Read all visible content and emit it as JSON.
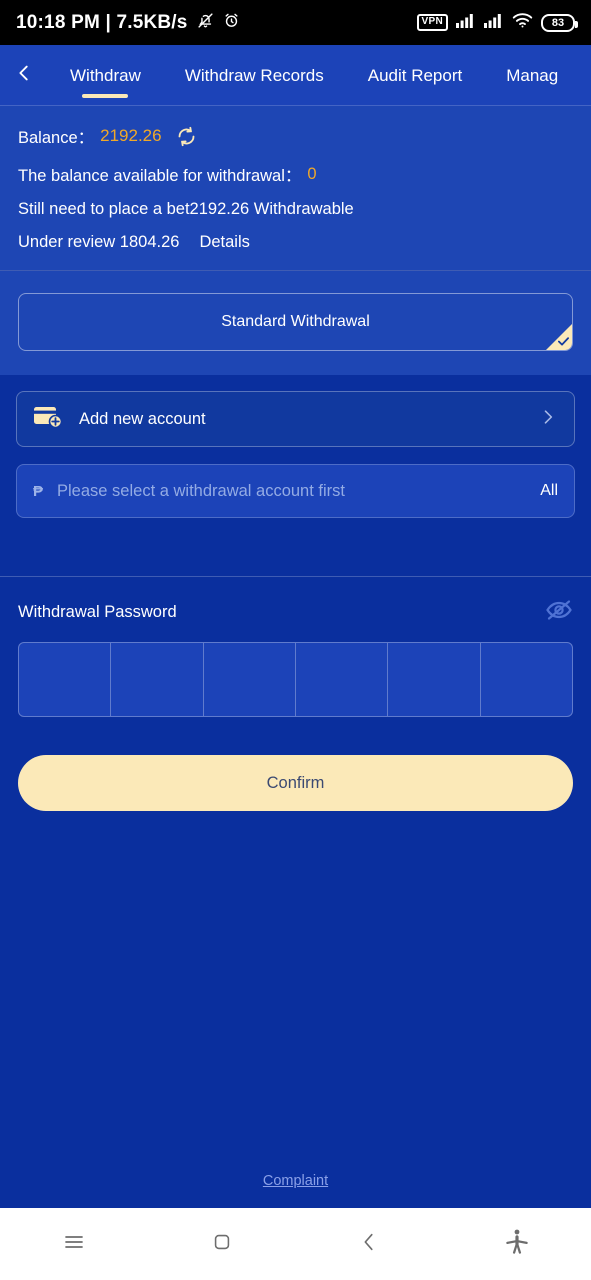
{
  "statusbar": {
    "clock": "10:18 PM | 7.5KB/s",
    "mute_icon": "bell-muted-icon",
    "alarm_icon": "alarm-clock-icon",
    "vpn_badge": "VPN",
    "signal1_icon": "signal-bars-icon",
    "signal2_icon": "signal-bars-icon",
    "wifi_icon": "wifi-icon",
    "battery_level": "83"
  },
  "tabbar": {
    "back_icon": "chevron-left-icon",
    "tabs": [
      {
        "label": "Withdraw",
        "active": true
      },
      {
        "label": "Withdraw Records",
        "active": false
      },
      {
        "label": "Audit Report",
        "active": false
      },
      {
        "label": "Manag",
        "active": false
      }
    ]
  },
  "info": {
    "balance_label": "Balance：",
    "balance_value": "2192.26",
    "refresh_icon": "refresh-icon",
    "available_label": "The balance available for withdrawal：",
    "available_value": "0",
    "bet_text": "Still need to place a bet2192.26  Withdrawable",
    "under_review_text": "Under review 1804.26",
    "details_link": "Details"
  },
  "method": {
    "standard_withdrawal": "Standard Withdrawal",
    "selected_icon": "corner-check-icon"
  },
  "account": {
    "card_icon": "card-plus-icon",
    "add_new_account": "Add new account",
    "chevron_icon": "chevron-right-icon"
  },
  "amount": {
    "currency_symbol": "₱",
    "placeholder": "Please select a withdrawal account first",
    "value": "",
    "all_label": "All"
  },
  "password": {
    "label": "Withdrawal Password",
    "toggle_icon": "eye-off-icon",
    "digits": [
      "",
      "",
      "",
      "",
      "",
      ""
    ]
  },
  "actions": {
    "confirm_label": "Confirm",
    "complaint_label": "Complaint"
  },
  "navbar": {
    "items": [
      {
        "icon": "menu-icon"
      },
      {
        "icon": "home-square-icon"
      },
      {
        "icon": "back-chevron-icon"
      },
      {
        "icon": "accessibility-icon"
      }
    ]
  },
  "colors": {
    "page_bg": "#0a2f9e",
    "header_bg": "#1e46b4",
    "accent_cream": "#fbe9b8",
    "amber": "#f0a829",
    "link_blue": "#8aa0e8"
  }
}
